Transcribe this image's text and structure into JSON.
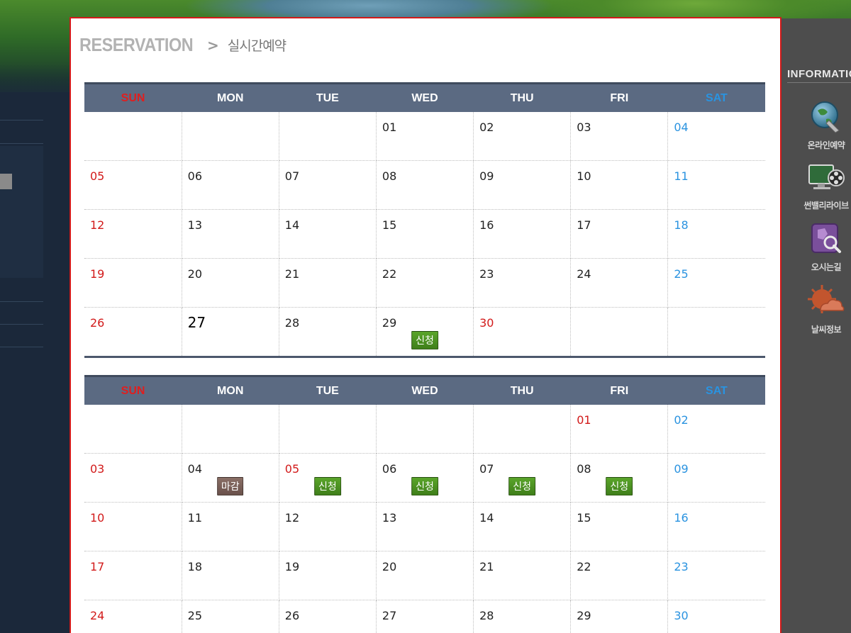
{
  "breadcrumb": {
    "main": "RESERVATION",
    "separator": ">",
    "current": "실시간예약"
  },
  "info": {
    "title": "INFORMATIC",
    "items": [
      {
        "label": "온라인예약",
        "icon": "online-reservation-icon"
      },
      {
        "label": "썬밸리라이브",
        "icon": "live-video-icon"
      },
      {
        "label": "오시는길",
        "icon": "map-directions-icon"
      },
      {
        "label": "날씨정보",
        "icon": "weather-icon"
      }
    ]
  },
  "weekdays": [
    "SUN",
    "MON",
    "TUE",
    "WED",
    "THU",
    "FRI",
    "SAT"
  ],
  "colors": {
    "header_bg": "#5b6a82",
    "sunday": "#d21a1a",
    "saturday": "#2a93e0",
    "apply_badge": "#4a8f20",
    "closed_badge": "#7a5f58",
    "panel_border": "#d21a1a"
  },
  "calendars": [
    {
      "weeks": [
        [
          {
            "d": ""
          },
          {
            "d": ""
          },
          {
            "d": ""
          },
          {
            "d": "01"
          },
          {
            "d": "02"
          },
          {
            "d": "03"
          },
          {
            "d": "04"
          }
        ],
        [
          {
            "d": "05"
          },
          {
            "d": "06"
          },
          {
            "d": "07"
          },
          {
            "d": "08"
          },
          {
            "d": "09"
          },
          {
            "d": "10"
          },
          {
            "d": "11"
          }
        ],
        [
          {
            "d": "12"
          },
          {
            "d": "13"
          },
          {
            "d": "14"
          },
          {
            "d": "15"
          },
          {
            "d": "16"
          },
          {
            "d": "17"
          },
          {
            "d": "18"
          }
        ],
        [
          {
            "d": "19"
          },
          {
            "d": "20"
          },
          {
            "d": "21"
          },
          {
            "d": "22"
          },
          {
            "d": "23"
          },
          {
            "d": "24"
          },
          {
            "d": "25"
          }
        ],
        [
          {
            "d": "26"
          },
          {
            "d": "27",
            "today": true
          },
          {
            "d": "28"
          },
          {
            "d": "29",
            "badge": "신청",
            "badge_type": "apply"
          },
          {
            "d": "30",
            "holiday": true
          },
          {
            "d": ""
          },
          {
            "d": ""
          }
        ]
      ]
    },
    {
      "weeks": [
        [
          {
            "d": ""
          },
          {
            "d": ""
          },
          {
            "d": ""
          },
          {
            "d": ""
          },
          {
            "d": ""
          },
          {
            "d": "01",
            "holiday": true
          },
          {
            "d": "02"
          }
        ],
        [
          {
            "d": "03"
          },
          {
            "d": "04",
            "badge": "마감",
            "badge_type": "closed"
          },
          {
            "d": "05",
            "holiday": true,
            "badge": "신청",
            "badge_type": "apply"
          },
          {
            "d": "06",
            "badge": "신청",
            "badge_type": "apply"
          },
          {
            "d": "07",
            "badge": "신청",
            "badge_type": "apply"
          },
          {
            "d": "08",
            "badge": "신청",
            "badge_type": "apply"
          },
          {
            "d": "09"
          }
        ],
        [
          {
            "d": "10"
          },
          {
            "d": "11"
          },
          {
            "d": "12"
          },
          {
            "d": "13"
          },
          {
            "d": "14"
          },
          {
            "d": "15"
          },
          {
            "d": "16"
          }
        ],
        [
          {
            "d": "17"
          },
          {
            "d": "18"
          },
          {
            "d": "19"
          },
          {
            "d": "20"
          },
          {
            "d": "21"
          },
          {
            "d": "22"
          },
          {
            "d": "23"
          }
        ],
        [
          {
            "d": "24"
          },
          {
            "d": "25"
          },
          {
            "d": "26"
          },
          {
            "d": "27"
          },
          {
            "d": "28"
          },
          {
            "d": "29"
          },
          {
            "d": "30"
          }
        ]
      ]
    }
  ]
}
